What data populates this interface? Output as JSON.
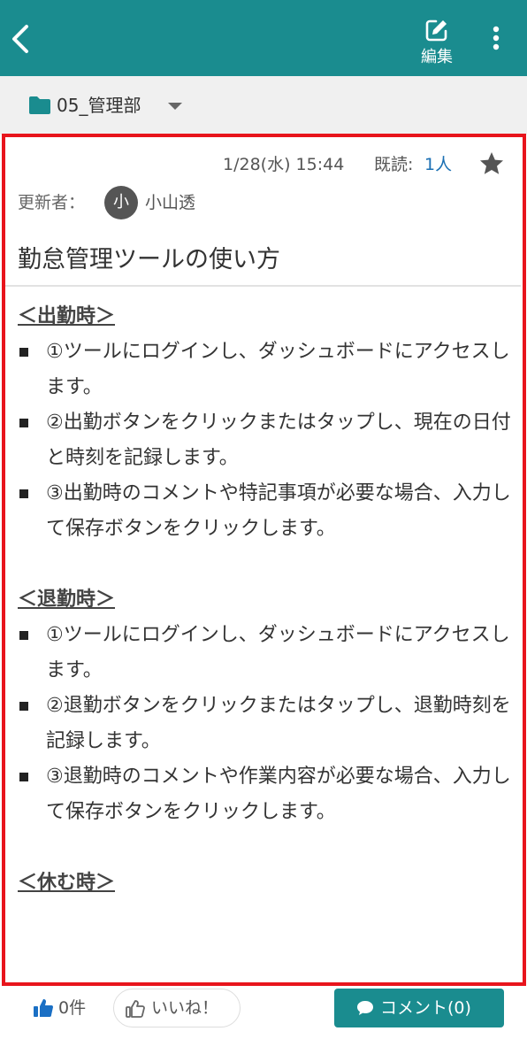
{
  "header": {
    "edit_label": "編集",
    "back_icon": "chevron-left-icon",
    "edit_icon": "edit-icon",
    "more_icon": "more-vertical-icon",
    "color": "#1a8c8f"
  },
  "folder": {
    "name": "05_管理部",
    "icon": "folder-icon",
    "icon_color": "#1a8c8f"
  },
  "post": {
    "datetime": "1/28(水) 15:44",
    "read_label": "既読:",
    "read_count": "1人",
    "updater_label": "更新者：",
    "updater_initial": "小",
    "updater_name": "小山透",
    "title": "勤怠管理ツールの使い方",
    "sections": [
      {
        "heading": "＜出勤時＞",
        "items": [
          "①ツールにログインし、ダッシュボードにアクセスします。",
          "②出勤ボタンをクリックまたはタップし、現在の日付と時刻を記録します。",
          "③出勤時のコメントや特記事項が必要な場合、入力して保存ボタンをクリックします。"
        ]
      },
      {
        "heading": "＜退勤時＞",
        "items": [
          "①ツールにログインし、ダッシュボードにアクセスします。",
          "②退勤ボタンをクリックまたはタップし、退勤時刻を記録します。",
          "③退勤時のコメントや作業内容が必要な場合、入力して保存ボタンをクリックします。"
        ]
      },
      {
        "heading": "＜休む時＞",
        "items": []
      }
    ]
  },
  "footer": {
    "like_count": "0件",
    "iine_label": "いいね！",
    "comment_label": "コメント(0)"
  },
  "colors": {
    "highlight_border": "#e8141c",
    "link": "#1a6fb3",
    "like_blue": "#1a6fc4"
  }
}
